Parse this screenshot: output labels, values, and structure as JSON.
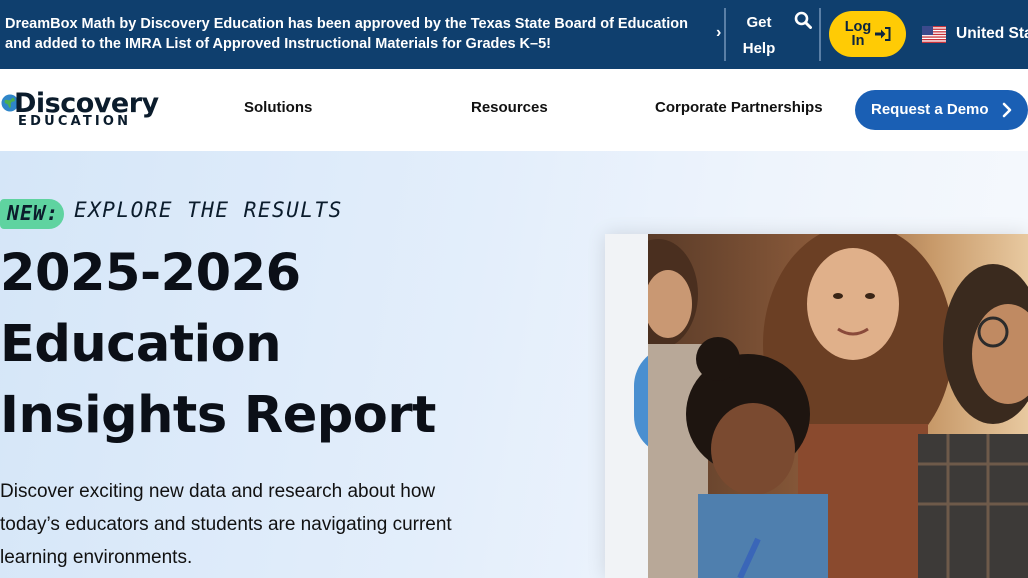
{
  "topbar": {
    "announcement": "DreamBox Math by Discovery Education has been approved by the Texas State Board of Education and added to the IMRA List of Approved Instructional Materials for Grades K–5!",
    "get_help": "Get Help",
    "login": "Log In",
    "country": "United Sta",
    "icons": {
      "arrow": "chevron-right-icon",
      "search": "search-icon",
      "login": "sign-in-icon",
      "flag": "us-flag-icon"
    }
  },
  "nav": {
    "logo_text": "Discovery",
    "logo_sub": "EDUCATION",
    "links": [
      "Solutions",
      "Resources",
      "Corporate Partnerships"
    ],
    "cta": "Request a Demo"
  },
  "hero": {
    "badge": "NEW:",
    "eyebrow": "EXPLORE THE RESULTS",
    "headline": "2025-2026 Education Insights Report",
    "body": "Discover exciting new data and research about how today’s educators and students are navigating current learning environments."
  },
  "colors": {
    "topbar": "#0f3f6e",
    "login": "#ffcb05",
    "cta": "#1a5fb4",
    "badge": "#5fd3a0"
  }
}
